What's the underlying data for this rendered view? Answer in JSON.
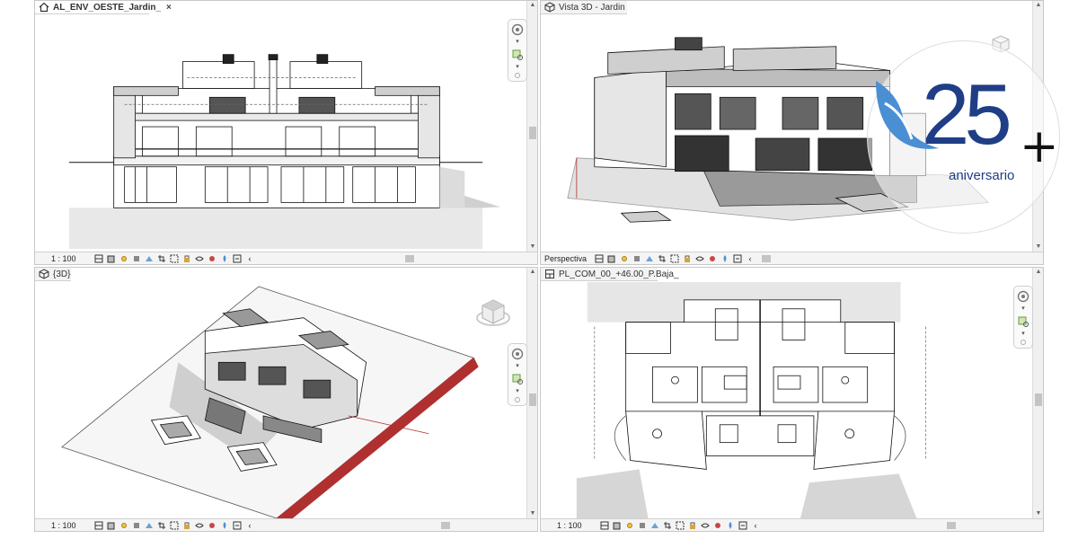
{
  "views": {
    "elevation": {
      "tab_label": "AL_ENV_OESTE_Jardin_",
      "close_glyph": "×",
      "scale": "1 : 100",
      "active": true
    },
    "perspective": {
      "tab_label": "Vista 3D - Jardin",
      "scale": "Perspectiva"
    },
    "axon3d": {
      "tab_label": "{3D}",
      "scale": "1 : 100"
    },
    "plan": {
      "tab_label": "PL_COM_00_+46.00_P.Baja_",
      "scale": "1 : 100"
    }
  },
  "badge": {
    "number": "25",
    "plus": "+",
    "caption": "aniversario",
    "colors": {
      "brand_blue": "#1f3e86",
      "light_blue": "#4a8fd4"
    }
  },
  "colors": {
    "ui_gray": "#f0f0f0",
    "line": "#111111",
    "terrain_red": "#b03030"
  },
  "icons": {
    "status_controls": [
      "detail-level-icon",
      "visual-style-icon",
      "sun-path-icon",
      "shadows-icon",
      "render-icon",
      "crop-icon",
      "show-crop-icon",
      "lock-3d-icon",
      "temporary-hide-icon",
      "reveal-hidden-icon",
      "analysis-icon",
      "highlight-icon"
    ],
    "navbar": [
      "steering-wheel-icon",
      "zoom-region-icon"
    ]
  }
}
